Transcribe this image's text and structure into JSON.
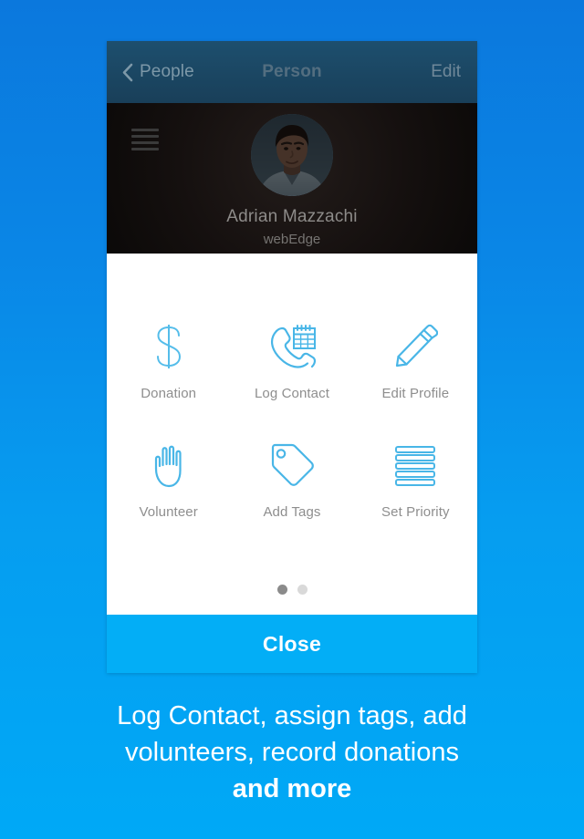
{
  "colors": {
    "background_top": "#0b78dd",
    "background_bottom": "#00a9f6",
    "navbar": "#1c4a68",
    "profile_background": "#15100f",
    "sheet_background": "#ffffff",
    "icon_blue": "#55bdea",
    "close_button": "#03aef6",
    "label_gray": "#8e8e8e"
  },
  "navbar": {
    "back_label": "People",
    "title": "Person",
    "edit_label": "Edit",
    "back_icon": "chevron-left-icon"
  },
  "profile": {
    "menu_icon": "hamburger-menu-icon",
    "avatar_icon": "user-avatar-photo",
    "name": "Adrian Mazzachi",
    "organization": "webEdge"
  },
  "actions": [
    {
      "label": "Donation",
      "icon": "dollar-sign-icon"
    },
    {
      "label": "Log Contact",
      "icon": "phone-calendar-icon"
    },
    {
      "label": "Edit Profile",
      "icon": "pencil-icon"
    },
    {
      "label": "Volunteer",
      "icon": "raised-hand-icon"
    },
    {
      "label": "Add Tags",
      "icon": "tag-icon"
    },
    {
      "label": "Set Priority",
      "icon": "priority-lines-icon"
    }
  ],
  "pager": {
    "total": 2,
    "active_index": 0
  },
  "close_button": {
    "label": "Close"
  },
  "caption": {
    "line1": "Log Contact, assign tags, add",
    "line2": "volunteers, record donations",
    "line3": "and more"
  }
}
